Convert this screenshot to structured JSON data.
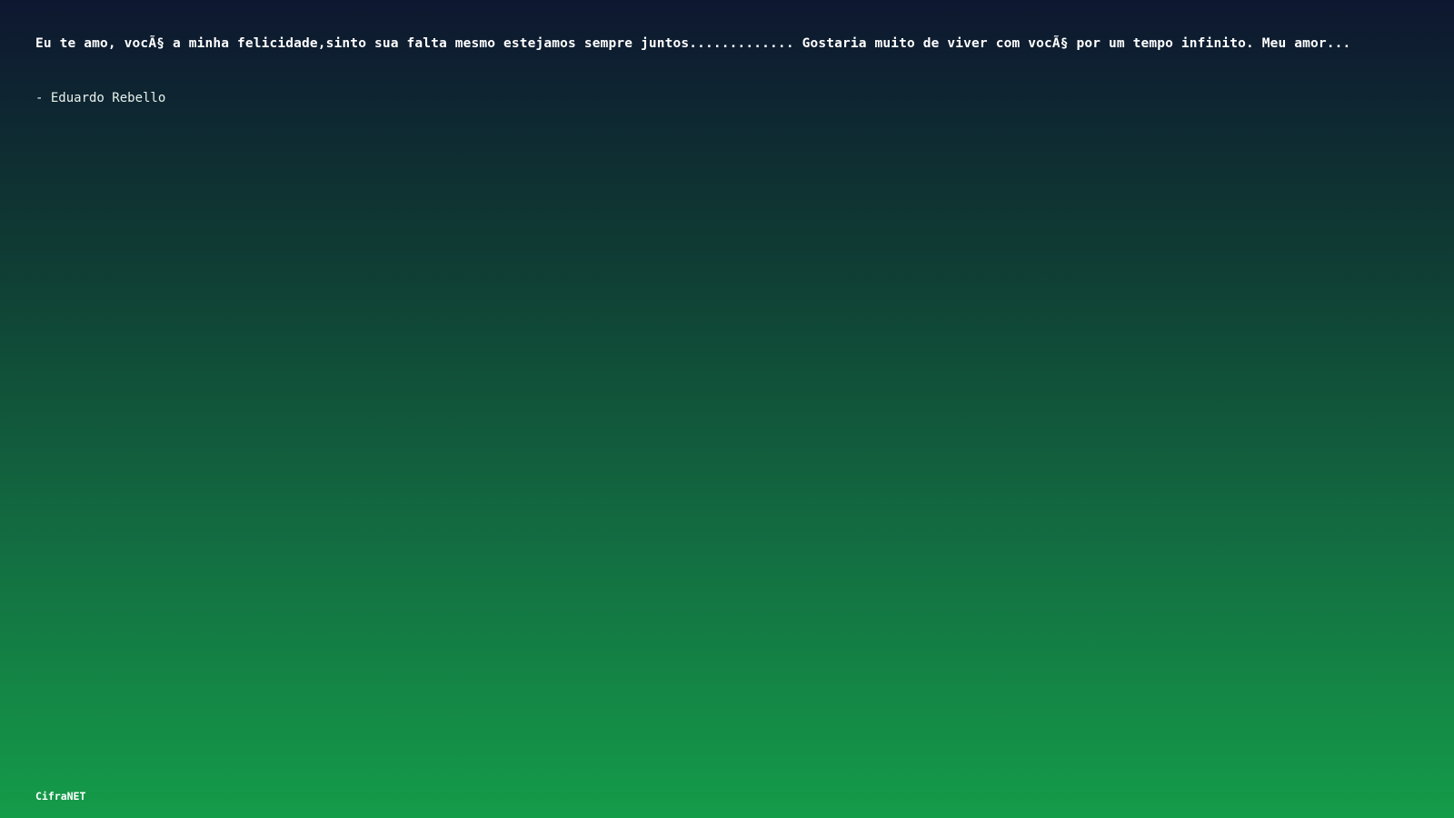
{
  "quote": {
    "text": "Eu te amo, vocÃ§ a minha felicidade,sinto sua falta mesmo estejamos sempre juntos............. Gostaria muito de viver com vocÃ§ por um tempo infinito. Meu amor..."
  },
  "author": {
    "text": "- Eduardo Rebello"
  },
  "brand": {
    "text": "CifraNET"
  },
  "colors": {
    "top": "#0e1730",
    "bottom": "#149c49",
    "text": "#ffffff"
  }
}
